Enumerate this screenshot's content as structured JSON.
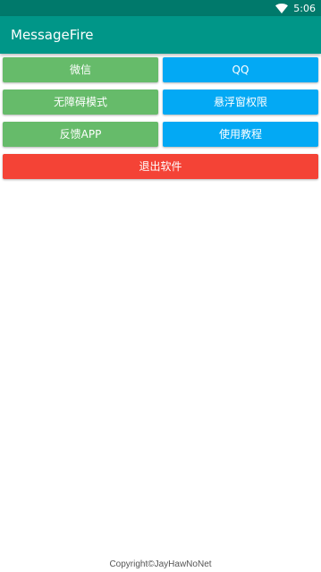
{
  "status_bar": {
    "time": "5:06",
    "wifi_icon": "wifi-icon"
  },
  "toolbar": {
    "title": "MessageFire",
    "color": "#009688",
    "status_color": "#00796b"
  },
  "buttons": {
    "wechat": "微信",
    "qq": "QQ",
    "accessibility": "无障碍模式",
    "overlay_permission": "悬浮窗权限",
    "feedback": "反馈APP",
    "tutorial": "使用教程",
    "exit": "退出软件"
  },
  "colors": {
    "green_button": "#66bb6a",
    "blue_button": "#03a9f4",
    "red_button": "#f44336"
  },
  "footer": {
    "copyright": "Copyright©JayHawNoNet"
  }
}
